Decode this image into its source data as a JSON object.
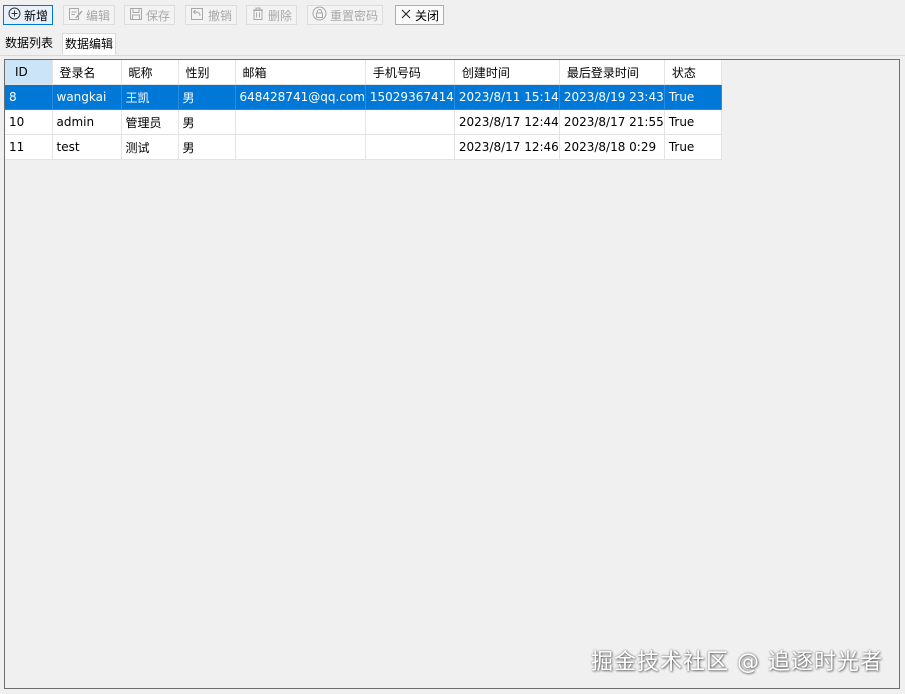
{
  "toolbar": {
    "new_label": "新增",
    "edit_label": "编辑",
    "save_label": "保存",
    "undo_label": "撤销",
    "delete_label": "删除",
    "reset_password_label": "重置密码",
    "close_label": "关闭"
  },
  "tabs": {
    "list_label": "数据列表",
    "edit_label": "数据编辑"
  },
  "grid": {
    "columns": [
      "ID",
      "登录名",
      "昵称",
      "性别",
      "邮箱",
      "手机号码",
      "创建时间",
      "最后登录时间",
      "状态"
    ],
    "rows": [
      [
        "8",
        "wangkai",
        "王凯",
        "男",
        "648428741@qq.com",
        "15029367414",
        "2023/8/11 15:14",
        "2023/8/19 23:43",
        "True"
      ],
      [
        "10",
        "admin",
        "管理员",
        "男",
        "",
        "",
        "2023/8/17 12:44",
        "2023/8/17 21:55",
        "True"
      ],
      [
        "11",
        "test",
        "测试",
        "男",
        "",
        "",
        "2023/8/17 12:46",
        "2023/8/18 0:29",
        "True"
      ]
    ]
  },
  "watermark": "掘金技术社区 @ 追逐时光者",
  "colors": {
    "selection": "#0078d7",
    "sorted_header": "#cce4f7",
    "disabled_text": "#a8a8a8"
  }
}
